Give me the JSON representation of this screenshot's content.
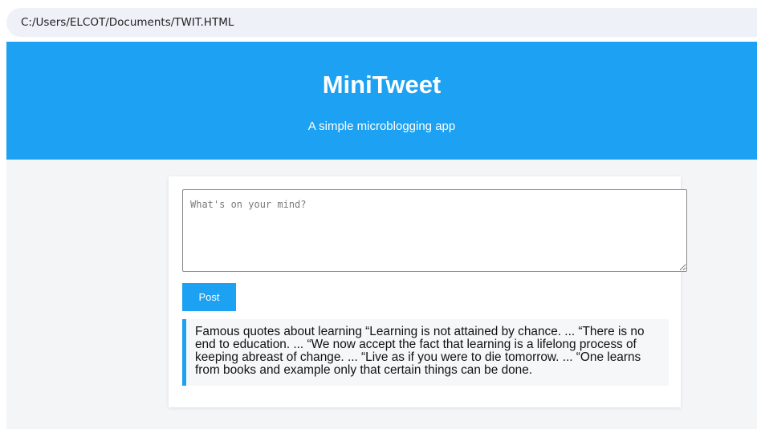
{
  "browser": {
    "address": "C:/Users/ELCOT/Documents/TWIT.HTML"
  },
  "header": {
    "title": "MiniTweet",
    "subtitle": "A simple microblogging app"
  },
  "composer": {
    "placeholder": "What's on your mind?",
    "value": "",
    "post_label": "Post"
  },
  "tweets": [
    {
      "text": "Famous quotes about learning “Learning is not attained by chance. ... “There is no end to education. ... “We now accept the fact that learning is a lifelong process of keeping abreast of change. ... “Live as if you were to die tomorrow. ... “One learns from books and example only that certain things can be done."
    }
  ],
  "colors": {
    "accent": "#1da1f2",
    "page_background": "#f4f5f7",
    "card_background": "#ffffff",
    "tweet_background": "#f6f7f9"
  }
}
